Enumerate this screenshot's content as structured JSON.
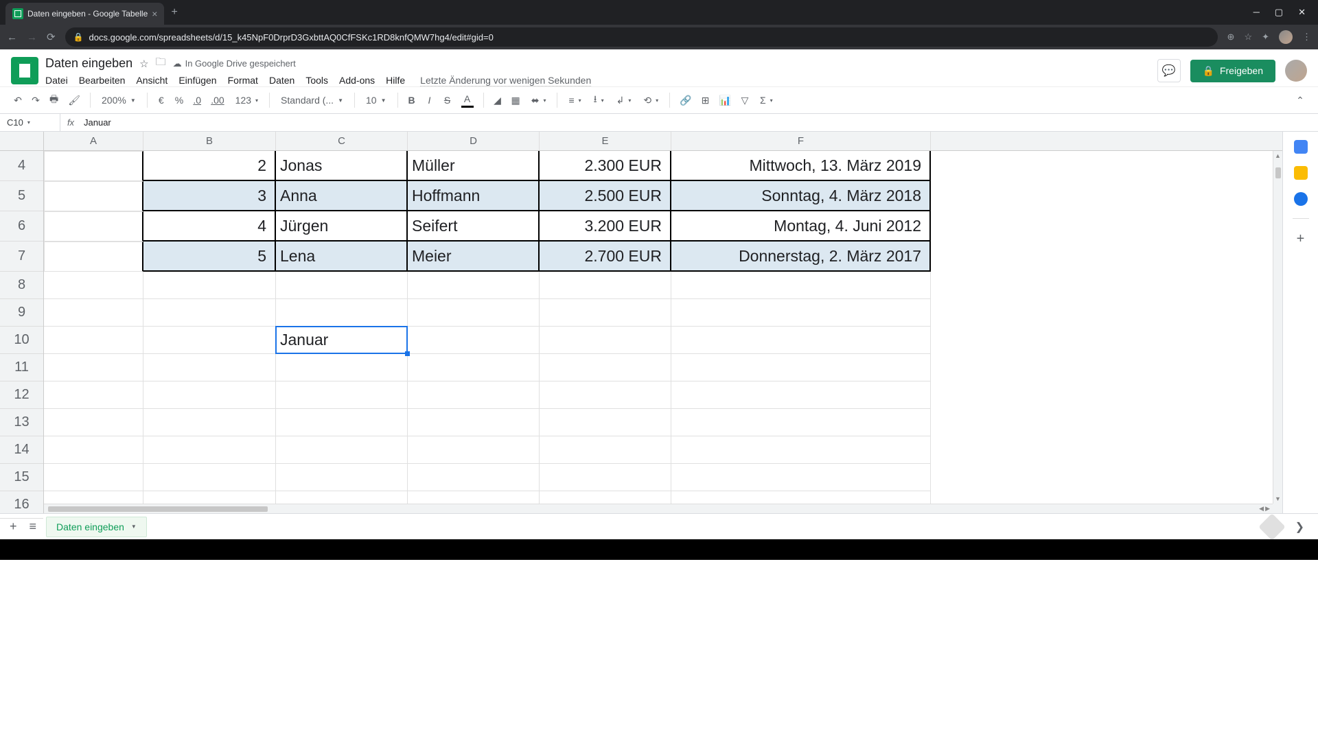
{
  "browser": {
    "tab_title": "Daten eingeben - Google Tabelle",
    "url": "docs.google.com/spreadsheets/d/15_k45NpF0DrprD3GxbttAQ0CfFSKc1RD8knfQMW7hg4/edit#gid=0"
  },
  "doc": {
    "title": "Daten eingeben",
    "save_status": "In Google Drive gespeichert",
    "last_edit": "Letzte Änderung vor wenigen Sekunden",
    "share_label": "Freigeben"
  },
  "menu": {
    "file": "Datei",
    "edit": "Bearbeiten",
    "view": "Ansicht",
    "insert": "Einfügen",
    "format": "Format",
    "data": "Daten",
    "tools": "Tools",
    "addons": "Add-ons",
    "help": "Hilfe"
  },
  "toolbar": {
    "zoom": "200%",
    "currency": "€",
    "percent": "%",
    "dec_dec": ".0",
    "inc_dec": ".00",
    "more_formats": "123",
    "font_style": "Standard (...",
    "font_size": "10"
  },
  "name_box": "C10",
  "formula_value": "Januar",
  "columns": [
    "A",
    "B",
    "C",
    "D",
    "E",
    "F"
  ],
  "visible_row_numbers": [
    4,
    5,
    6,
    7,
    8,
    9,
    10,
    11,
    12,
    13,
    14,
    15,
    16
  ],
  "data_rows": [
    {
      "b": "2",
      "c": "Jonas",
      "d": "Müller",
      "e": "2.300 EUR",
      "f": "Mittwoch, 13. März 2019",
      "stripe": false
    },
    {
      "b": "3",
      "c": "Anna",
      "d": "Hoffmann",
      "e": "2.500 EUR",
      "f": "Sonntag, 4. März 2018",
      "stripe": true
    },
    {
      "b": "4",
      "c": "Jürgen",
      "d": "Seifert",
      "e": "3.200 EUR",
      "f": "Montag, 4. Juni 2012",
      "stripe": false
    },
    {
      "b": "5",
      "c": "Lena",
      "d": "Meier",
      "e": "2.700 EUR",
      "f": "Donnerstag, 2. März 2017",
      "stripe": true
    }
  ],
  "selected_cell": {
    "row_index": 6,
    "col": "C",
    "value": "Januar"
  },
  "sheet_tab": "Daten eingeben"
}
